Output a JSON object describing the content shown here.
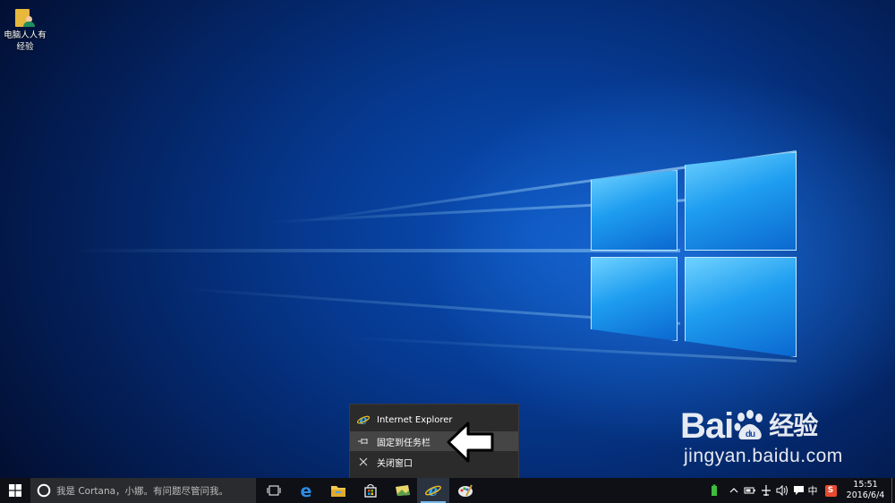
{
  "desktop": {
    "icons": [
      {
        "label_line1": "电脑人人有",
        "label_line2": "经验",
        "icon": "user-folder-icon"
      }
    ]
  },
  "context_menu": {
    "items": [
      {
        "label": "Internet Explorer",
        "icon": "ie-icon"
      },
      {
        "label": "固定到任务栏",
        "icon": "pin-icon",
        "highlighted": true
      },
      {
        "label": "关闭窗口",
        "icon": "close-icon"
      }
    ]
  },
  "watermark": {
    "brand": "Bai",
    "brand_suffix": "经验",
    "url": "jingyan.baidu.com"
  },
  "taskbar": {
    "search_placeholder": "我是 Cortana，小娜。有问题尽管问我。",
    "apps": [
      {
        "name": "task-view",
        "icon": "task-view-icon"
      },
      {
        "name": "edge",
        "icon": "edge-icon"
      },
      {
        "name": "file-explorer",
        "icon": "folder-icon"
      },
      {
        "name": "store",
        "icon": "store-icon"
      },
      {
        "name": "photos",
        "icon": "photos-icon"
      },
      {
        "name": "internet-explorer",
        "icon": "ie-icon",
        "active": true
      },
      {
        "name": "paint",
        "icon": "paint-icon"
      }
    ],
    "tray": {
      "ime_label": "中",
      "ime_app_label": "S"
    },
    "clock": {
      "time": "15:51",
      "date": "2016/6/4"
    }
  },
  "colors": {
    "accent": "#0a6fd6",
    "taskbar": "#0e1016",
    "menu": "#2b2b2b"
  }
}
